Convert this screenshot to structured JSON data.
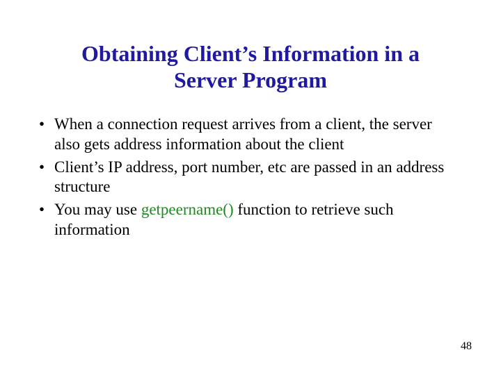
{
  "title_line1": "Obtaining Client’s Information in a",
  "title_line2": "Server Program",
  "bullets": {
    "b1": "When a connection request arrives from a client, the server also gets address information about the client",
    "b2": "Client’s IP address, port number, etc are passed in an address structure",
    "b3_pre": "You may use ",
    "b3_fn": "getpeername()",
    "b3_post": " function to retrieve such information"
  },
  "page_number": "48"
}
